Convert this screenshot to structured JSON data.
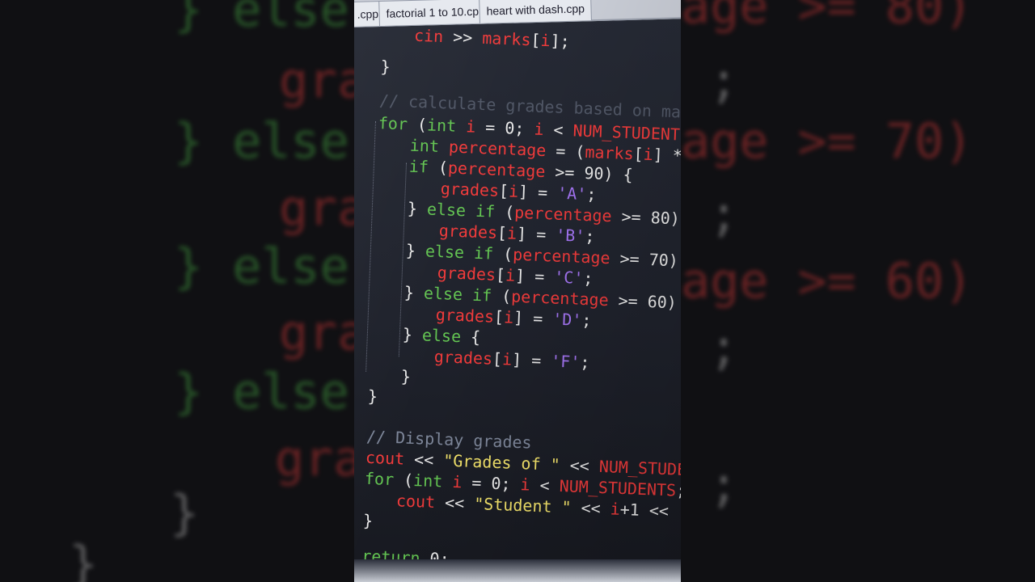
{
  "tabs": [
    {
      "label": ".cpp"
    },
    {
      "label": "factorial 1 to 10.cpp"
    },
    {
      "label": "heart with dash.cpp"
    }
  ],
  "side": {
    "else": "} else",
    "grad": "gra",
    "age80": "age >= 80)",
    "age70": "age >= 70)",
    "age60": "age >= 60)",
    "semi": ";",
    "brace": "}"
  },
  "code": {
    "l1": {
      "a": "cin",
      "b": " >> ",
      "c": "marks",
      "d": "[",
      "e": "i",
      "f": "];"
    },
    "l2": "}",
    "l3": "// calculate grades based on marks",
    "l4": {
      "kw": "for",
      "p1": " (",
      "ty": "int",
      "v": " i",
      "eq": " = 0; ",
      "v2": "i",
      "lt": " < ",
      "c": "NUM_STUDENTS",
      "end": ";"
    },
    "l5": {
      "ty": "int",
      "v": " percentage",
      "eq": " = (",
      "c": "marks",
      "b": "[",
      "i": "i",
      "e": "] *"
    },
    "l6": {
      "kw": "if",
      "p": " (",
      "v": "percentage",
      "op": " >= 90) {"
    },
    "l7": {
      "v": "grades",
      "b": "[",
      "i": "i",
      "e": "] = ",
      "s": "'A'",
      "end": ";"
    },
    "l8": {
      "br": "} ",
      "kw": "else if",
      "p": " (",
      "v": "percentage",
      "op": " >= 80)"
    },
    "l9": {
      "v": "grades",
      "b": "[",
      "i": "i",
      "e": "] = ",
      "s": "'B'",
      "end": ";"
    },
    "l10": {
      "br": "} ",
      "kw": "else if",
      "p": " (",
      "v": "percentage",
      "op": " >= 70)"
    },
    "l11": {
      "v": "grades",
      "b": "[",
      "i": "i",
      "e": "] = ",
      "s": "'C'",
      "end": ";"
    },
    "l12": {
      "br": "} ",
      "kw": "else if",
      "p": " (",
      "v": "percentage",
      "op": " >= 60)"
    },
    "l13": {
      "v": "grades",
      "b": "[",
      "i": "i",
      "e": "] = ",
      "s": "'D'",
      "end": ";"
    },
    "l14": {
      "br": "} ",
      "kw": "else",
      "p": " {"
    },
    "l15": {
      "v": "grades",
      "b": "[",
      "i": "i",
      "e": "] = ",
      "s": "'F'",
      "end": ";"
    },
    "l16": "}",
    "l17": "}",
    "l18": "// Display grades",
    "l19": {
      "a": "cout",
      "b": " << ",
      "s": "\"Grades of \"",
      "c": " << ",
      "d": "NUM_STUDEN"
    },
    "l20": {
      "kw": "for",
      "p1": " (",
      "ty": "int",
      "v": " i",
      "eq": " = 0; ",
      "v2": "i",
      "lt": " < ",
      "c": "NUM_STUDENTS",
      "end": ";"
    },
    "l21": {
      "a": "cout",
      "b": " << ",
      "s": "\"Student \"",
      "c": " << ",
      "i": "i",
      "e": "+1",
      "f": " << \""
    },
    "l22": "}",
    "l23": {
      "kw": "return",
      "e": " 0;"
    }
  },
  "colors": {
    "keyword": "#63c452",
    "identifier": "#f03b3b",
    "char": "#a374f2",
    "string": "#f2e26a",
    "comment": "#7e879a"
  }
}
